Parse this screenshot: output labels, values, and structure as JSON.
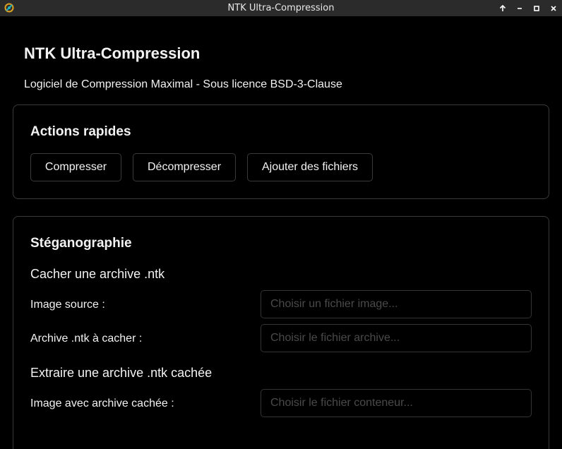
{
  "window": {
    "title": "NTK Ultra-Compression",
    "controls": [
      "arrow-up-icon",
      "minimize-icon",
      "maximize-icon",
      "close-icon"
    ]
  },
  "header": {
    "title": "NTK Ultra-Compression",
    "subtitle": "Logiciel de Compression Maximal - Sous licence BSD-3-Clause"
  },
  "quick_actions": {
    "title": "Actions rapides",
    "compress_label": "Compresser",
    "decompress_label": "Décompresser",
    "add_files_label": "Ajouter des fichiers"
  },
  "steganography": {
    "title": "Stéganographie",
    "hide": {
      "heading": "Cacher une archive .ntk",
      "image_source_label": "Image source :",
      "image_source_placeholder": "Choisir un fichier image...",
      "archive_label": "Archive .ntk à cacher :",
      "archive_placeholder": "Choisir le fichier archive..."
    },
    "extract": {
      "heading": "Extraire une archive .ntk cachée",
      "container_label": "Image avec archive cachée :",
      "container_placeholder": "Choisir le fichier conteneur..."
    }
  },
  "colors": {
    "background": "#000000",
    "titlebar": "#2b2b2b",
    "border": "#3a3a3a",
    "text": "#f2f2f2",
    "placeholder": "#4a4a4a"
  }
}
